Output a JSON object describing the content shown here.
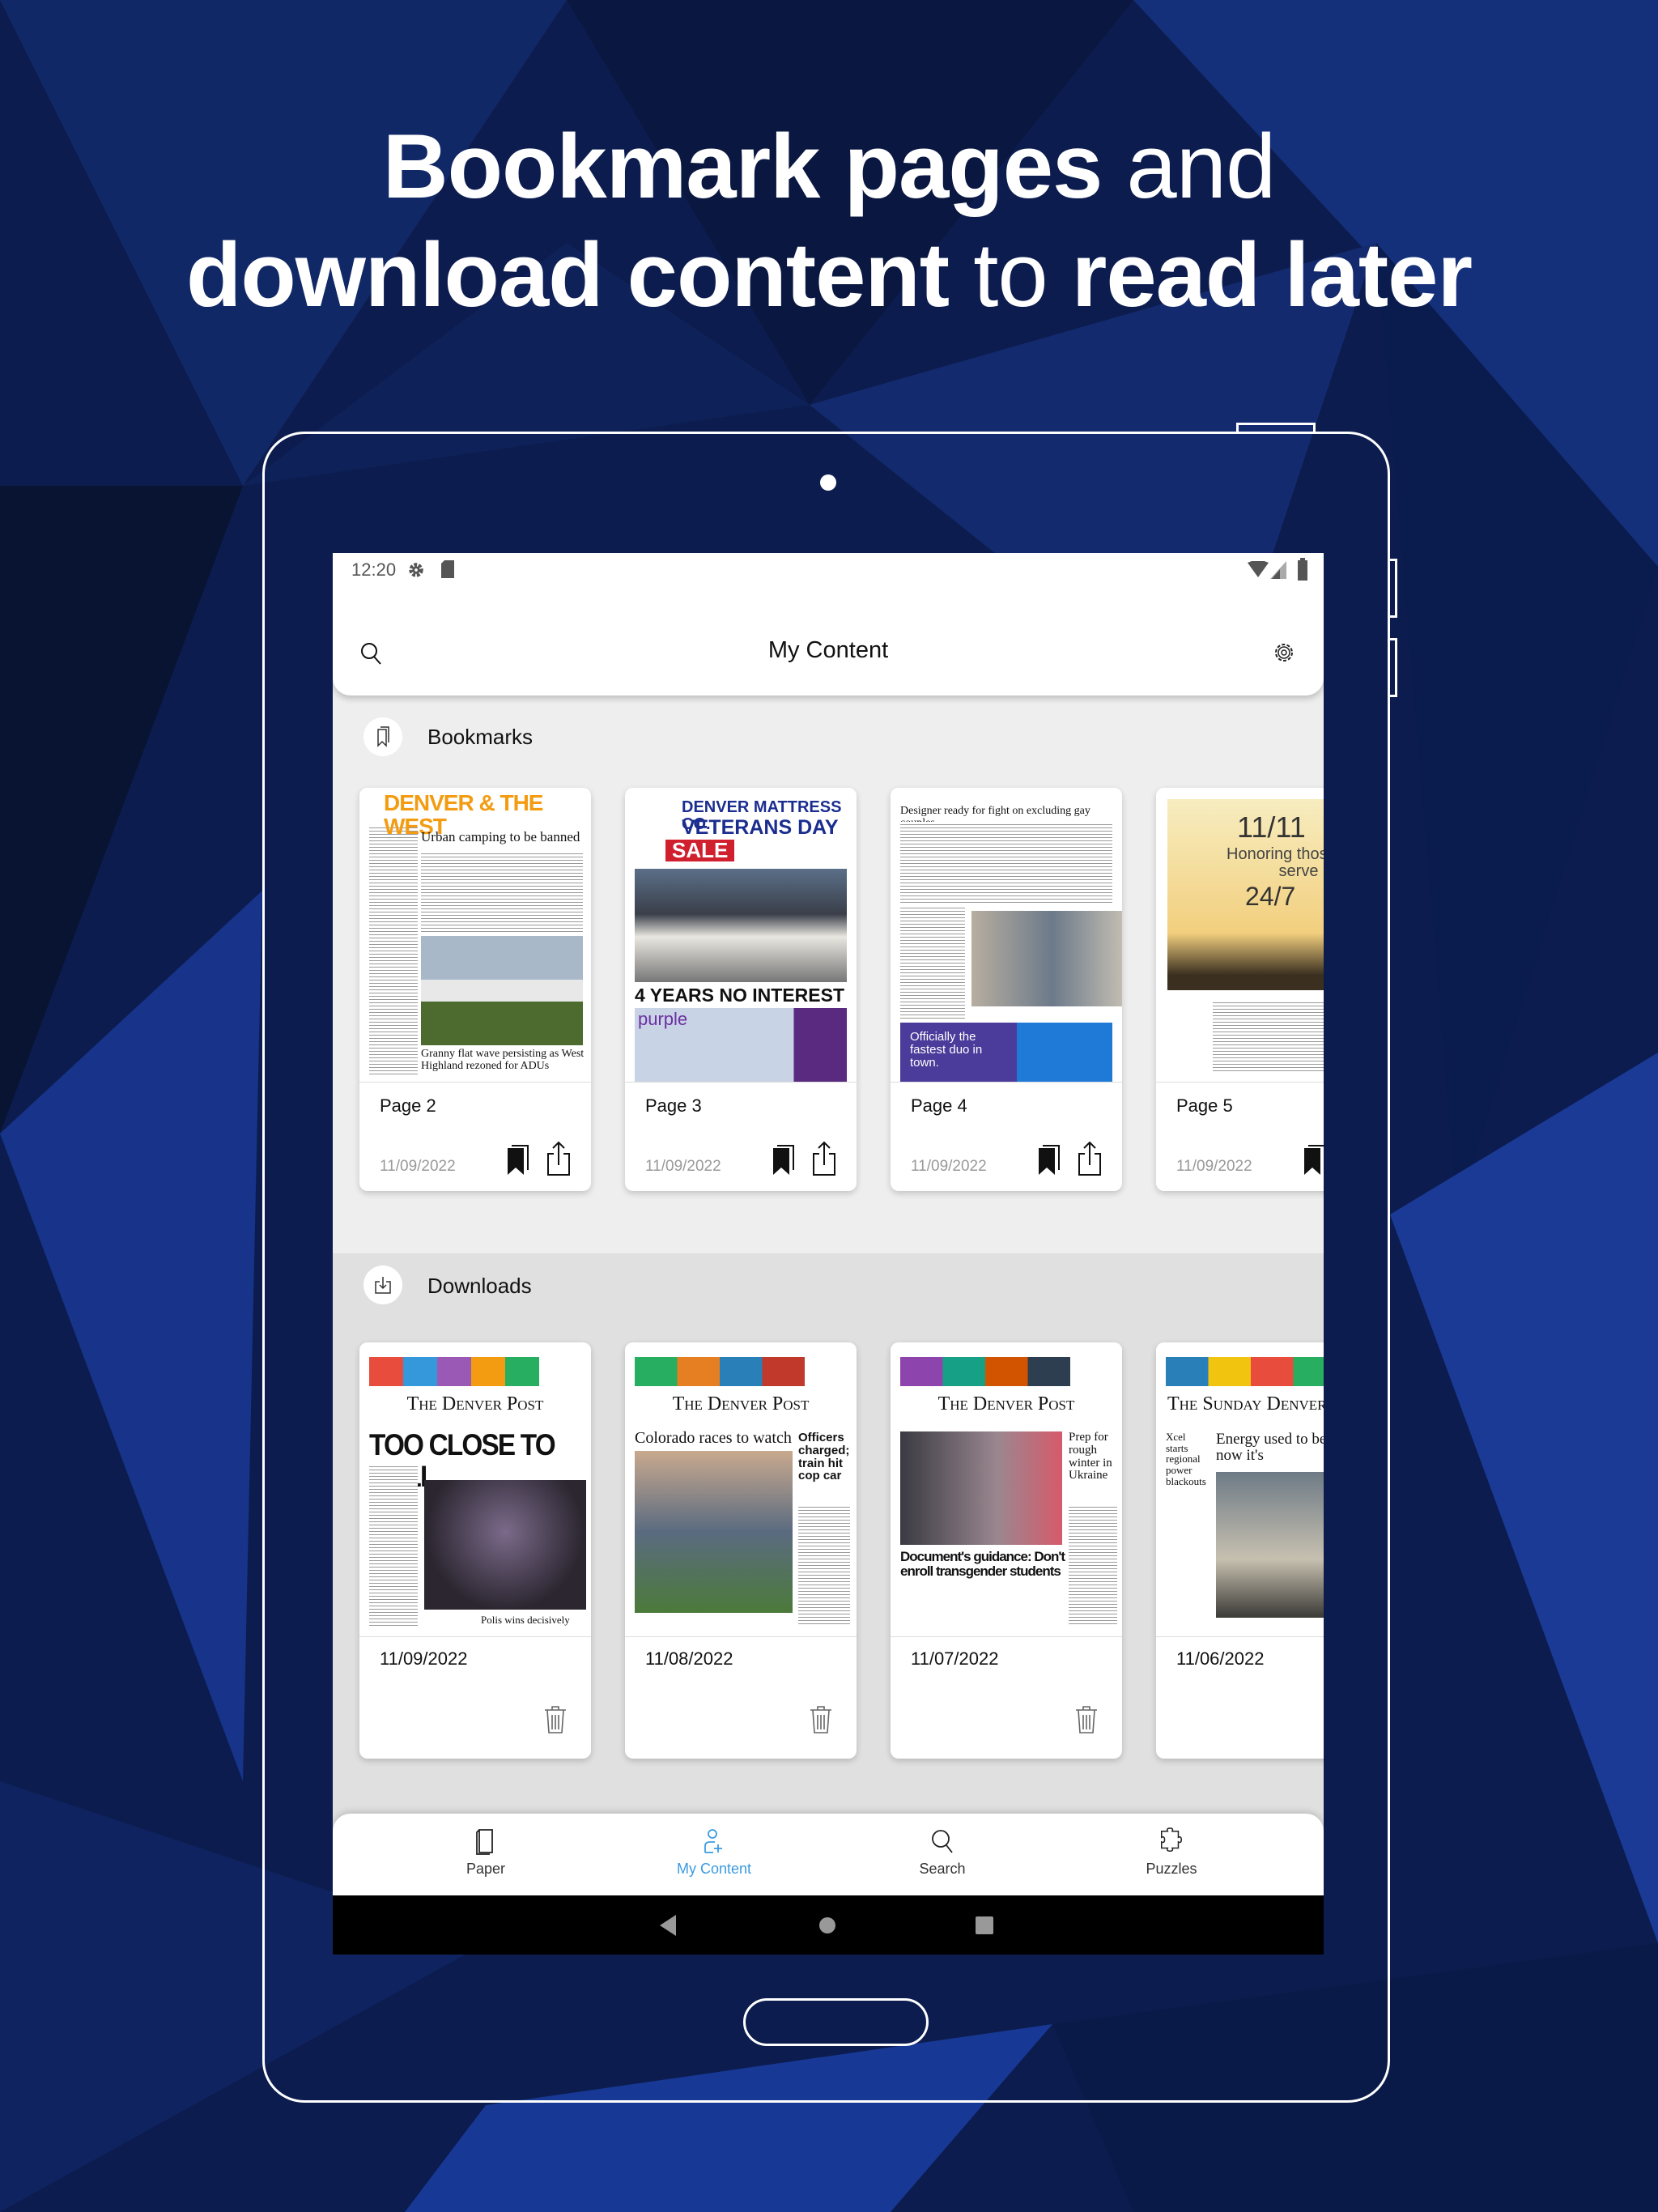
{
  "headline": {
    "line1_bold": "Bookmark pages",
    "line1_regular": "and",
    "line2_bold_a": "download content",
    "line2_regular": "to",
    "line2_bold_b": "read later"
  },
  "status_bar": {
    "time": "12:20",
    "icons": [
      "gear-icon",
      "sd-card-icon",
      "wifi-icon",
      "signal-icon",
      "battery-icon"
    ]
  },
  "header": {
    "title": "My Content",
    "left_icon": "search-icon",
    "right_icon": "gear-icon"
  },
  "bookmarks": {
    "label": "Bookmarks",
    "icon": "bookmark-icon",
    "items": [
      {
        "page": "Page 2",
        "date": "11/09/2022",
        "thumb": {
          "masthead": "DENVER & THE WEST",
          "headline": "Urban camping to be banned",
          "sub": "Granny flat wave persisting as West Highland rezoned for ADUs"
        }
      },
      {
        "page": "Page 3",
        "date": "11/09/2022",
        "thumb": {
          "masthead": "DENVER MATTRESS CO.",
          "headline": "VETERANS DAY",
          "badge": "SALE",
          "sub": "4 YEARS NO INTEREST",
          "brand": "purple"
        }
      },
      {
        "page": "Page 4",
        "date": "11/09/2022",
        "thumb": {
          "headline": "Designer ready for fight on excluding gay couples",
          "sub": "Officially the fastest duo in town."
        }
      },
      {
        "page": "Page 5",
        "date": "11/09/2022",
        "thumb": {
          "headline": "11/11",
          "sub": "Honoring those who serve",
          "tag": "24/7"
        }
      }
    ]
  },
  "downloads": {
    "label": "Downloads",
    "icon": "download-icon",
    "items": [
      {
        "date": "11/09/2022",
        "thumb": {
          "masthead": "The Denver Post",
          "headline": "TOO CLOSE TO CALL",
          "sub": "Polis wins decisively"
        }
      },
      {
        "date": "11/08/2022",
        "thumb": {
          "masthead": "The Denver Post",
          "headline": "Colorado races to watch",
          "sub": "Officers charged; train hit cop car"
        }
      },
      {
        "date": "11/07/2022",
        "thumb": {
          "masthead": "The Denver Post",
          "headline": "Document's guidance: Don't enroll transgender students",
          "sub": "Prep for rough winter in Ukraine"
        }
      },
      {
        "date": "11/06/2022",
        "thumb": {
          "masthead": "The Sunday Denver Post",
          "headline": "Energy used to be for Weld; now it's",
          "sub": "Xcel starts regional power blackouts"
        }
      }
    ]
  },
  "bottom_nav": {
    "active_color": "#3b9be0",
    "items": [
      {
        "label": "Paper",
        "icon": "newspaper-icon"
      },
      {
        "label": "My Content",
        "icon": "user-plus-icon",
        "active": true
      },
      {
        "label": "Search",
        "icon": "search-icon"
      },
      {
        "label": "Puzzles",
        "icon": "puzzle-icon"
      }
    ]
  },
  "system_nav": [
    "back-icon",
    "home-icon",
    "recents-icon"
  ]
}
